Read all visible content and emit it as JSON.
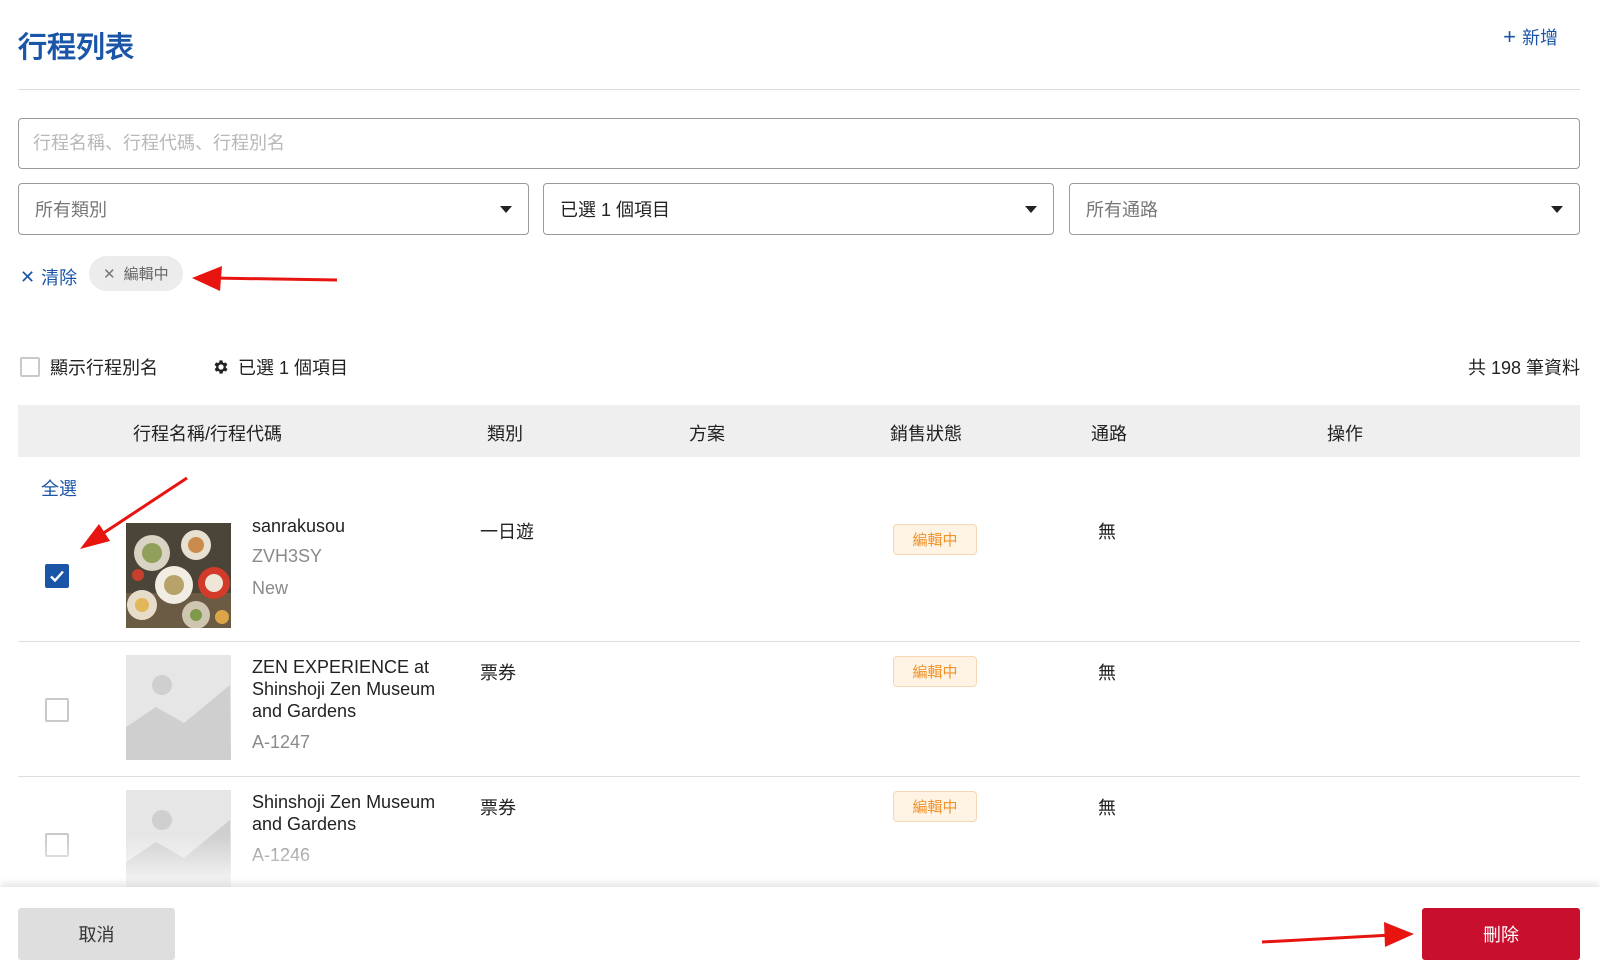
{
  "header": {
    "title": "行程列表",
    "add_label": "新增"
  },
  "search": {
    "placeholder": "行程名稱、行程代碼、行程別名",
    "value": ""
  },
  "filters": {
    "category": "所有類別",
    "status": "已選 1 個項目",
    "channel": "所有通路"
  },
  "active_filters": {
    "clear_label": "清除",
    "chips": [
      "編輯中"
    ]
  },
  "toolbar": {
    "show_alias_label": "顯示行程別名",
    "selected_label": "已選 1 個項目",
    "total_label": "共 198 筆資料"
  },
  "table": {
    "columns": [
      "行程名稱/行程代碼",
      "類別",
      "方案",
      "銷售狀態",
      "通路",
      "操作"
    ],
    "select_all": "全選",
    "rows": [
      {
        "checked": true,
        "name": "sanrakusou",
        "code": "ZVH3SY",
        "tag": "New",
        "category": "一日遊",
        "plan": "",
        "status": "編輯中",
        "channel": "無",
        "image": "food-photo"
      },
      {
        "checked": false,
        "name": "ZEN EXPERIENCE at Shinshoji Zen Museum and Gardens",
        "code": "A-1247",
        "tag": "",
        "category": "票券",
        "plan": "",
        "status": "編輯中",
        "channel": "無",
        "image": "image-placeholder-icon"
      },
      {
        "checked": false,
        "name": "Shinshoji Zen Museum and Gardens",
        "code": "A-1246",
        "tag": "",
        "category": "票券",
        "plan": "",
        "status": "編輯中",
        "channel": "無",
        "image": "image-placeholder-icon"
      }
    ]
  },
  "footer": {
    "cancel_label": "取消",
    "delete_label": "刪除"
  },
  "colors": {
    "primary": "#1a55a8",
    "danger": "#c8102e",
    "status_text": "#f0932b",
    "status_bg": "#fff3e4",
    "annotation": "#e8140f"
  }
}
